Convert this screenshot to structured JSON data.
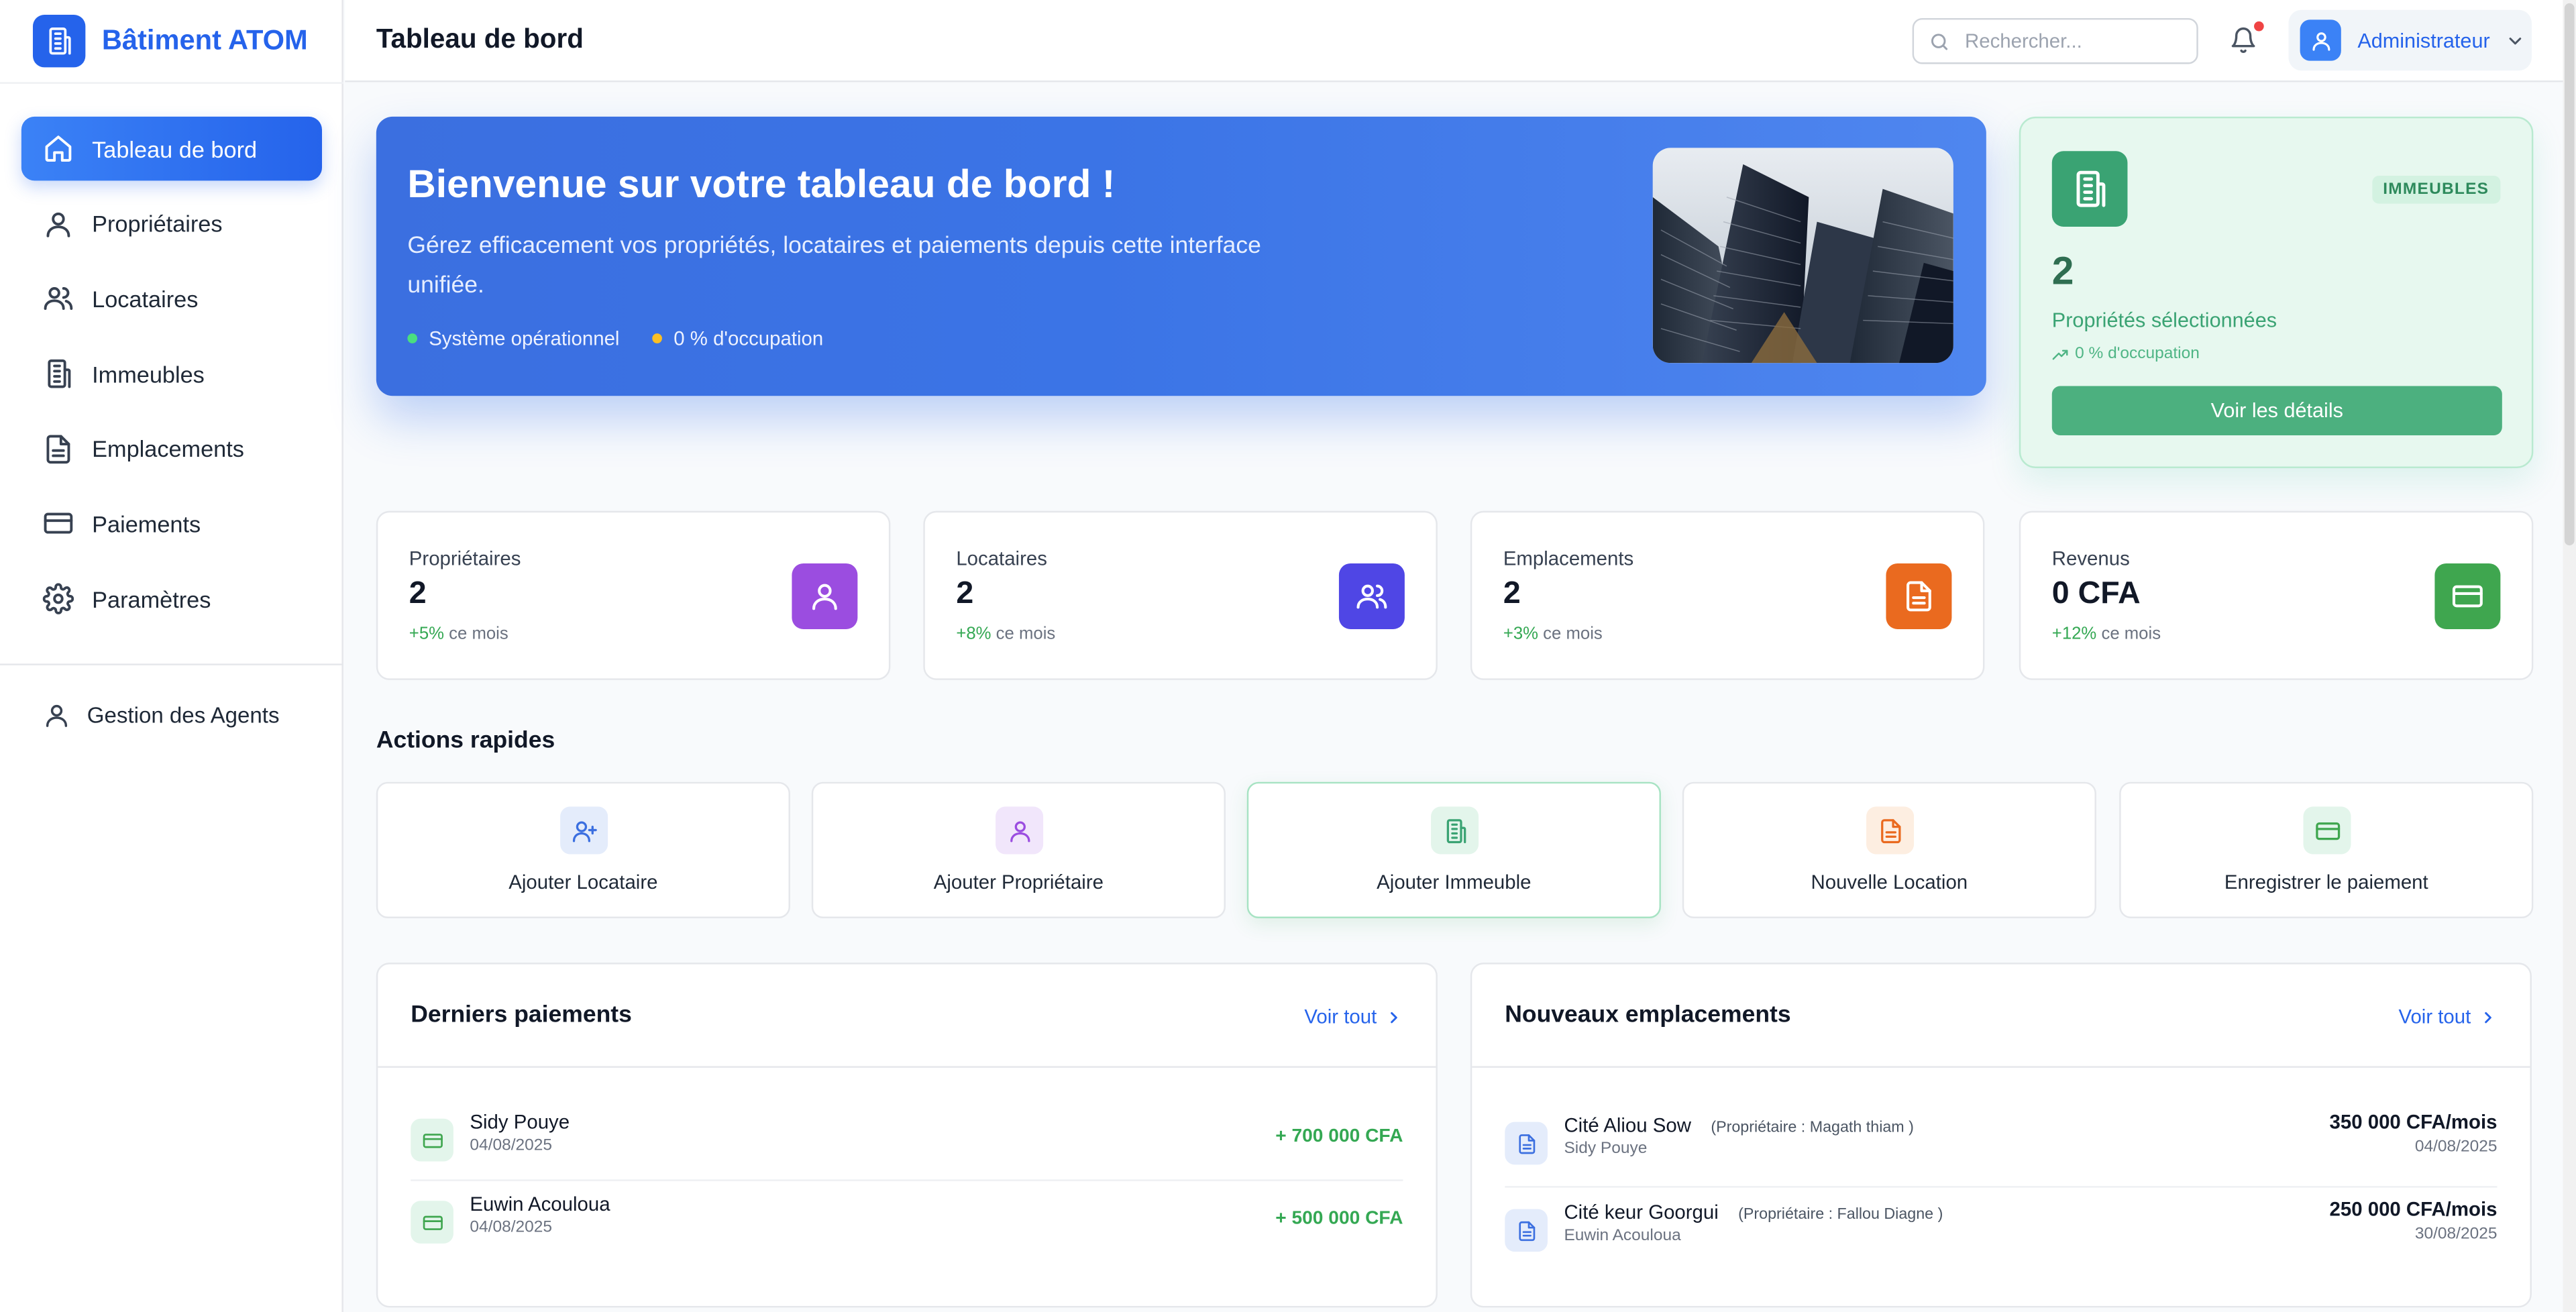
{
  "app": {
    "name": "Bâtiment ATOM"
  },
  "sidebar": {
    "items": [
      {
        "label": "Tableau de bord",
        "icon": "home-icon",
        "active": true
      },
      {
        "label": "Propriétaires",
        "icon": "user-icon"
      },
      {
        "label": "Locataires",
        "icon": "users-icon"
      },
      {
        "label": "Immeubles",
        "icon": "building-icon"
      },
      {
        "label": "Emplacements",
        "icon": "document-icon"
      },
      {
        "label": "Paiements",
        "icon": "credit-card-icon"
      },
      {
        "label": "Paramètres",
        "icon": "gear-icon"
      }
    ],
    "agents": {
      "label": "Gestion des Agents",
      "icon": "user-icon"
    }
  },
  "header": {
    "title": "Tableau de bord",
    "search_placeholder": "Rechercher...",
    "user_name": "Administrateur"
  },
  "hero": {
    "title": "Bienvenue sur votre tableau de bord !",
    "subtitle": "Gérez efficacement vos propriétés, locataires et paiements depuis cette interface unifiée.",
    "status": "Système opérationnel",
    "occupancy": "0 % d'occupation",
    "status_color": "#4ade80",
    "occupancy_color": "#fbbf24"
  },
  "immeubles_card": {
    "badge": "IMMEUBLES",
    "count": "2",
    "label": "Propriétés sélectionnées",
    "occupancy": "0 % d'occupation",
    "button": "Voir les détails",
    "accent": "#3aa373"
  },
  "stats": [
    {
      "label": "Propriétaires",
      "value": "2",
      "pct": "+5%",
      "period": "ce mois",
      "color": "#9b4de0",
      "icon": "user-icon"
    },
    {
      "label": "Locataires",
      "value": "2",
      "pct": "+8%",
      "period": "ce mois",
      "color": "#4f46e5",
      "icon": "users-icon"
    },
    {
      "label": "Emplacements",
      "value": "2",
      "pct": "+3%",
      "period": "ce mois",
      "color": "#ea6a1f",
      "icon": "document-icon"
    },
    {
      "label": "Revenus",
      "value": "0 CFA",
      "pct": "+12%",
      "period": "ce mois",
      "color": "#3fa64f",
      "icon": "credit-card-icon"
    }
  ],
  "quick_actions": {
    "title": "Actions rapides",
    "items": [
      {
        "label": "Ajouter Locataire",
        "icon": "user-plus-icon",
        "bg": "#e4ecfb",
        "fg": "#3b6fe0"
      },
      {
        "label": "Ajouter Propriétaire",
        "icon": "user-icon",
        "bg": "#f1e6fb",
        "fg": "#9b4de0"
      },
      {
        "label": "Ajouter Immeuble",
        "icon": "building-icon",
        "bg": "#e3f5eb",
        "fg": "#3aa373"
      },
      {
        "label": "Nouvelle Location",
        "icon": "document-icon",
        "bg": "#fdeee1",
        "fg": "#ea6a1f"
      },
      {
        "label": "Enregistrer le paiement",
        "icon": "credit-card-icon",
        "bg": "#e3f5eb",
        "fg": "#3fa64f"
      }
    ]
  },
  "payments": {
    "title": "Derniers paiements",
    "link": "Voir tout",
    "rows": [
      {
        "name": "Sidy Pouye",
        "date": "04/08/2025",
        "amount": "+ 700 000 CFA"
      },
      {
        "name": "Euwin Acouloua",
        "date": "04/08/2025",
        "amount": "+ 500 000 CFA"
      }
    ]
  },
  "locations": {
    "title": "Nouveaux emplacements",
    "link": "Voir tout",
    "rows": [
      {
        "name": "Cité Aliou Sow",
        "owner": "(Propriétaire : Magath thiam )",
        "tenant": "Sidy Pouye",
        "price": "350 000 CFA/mois",
        "date": "04/08/2025"
      },
      {
        "name": "Cité keur Goorgui",
        "owner": "(Propriétaire : Fallou Diagne )",
        "tenant": "Euwin Acouloua",
        "price": "250 000 CFA/mois",
        "date": "30/08/2025"
      }
    ]
  }
}
